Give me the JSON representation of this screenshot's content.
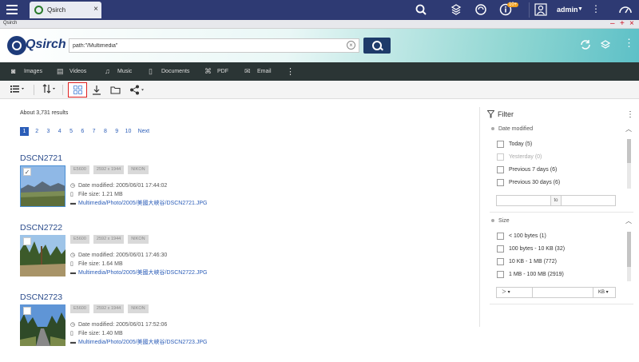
{
  "topbar": {
    "tab_label": "Qsirch",
    "tab_close": "×",
    "notification_badge": "10+",
    "user": "admin"
  },
  "window": {
    "title": "Qsirch"
  },
  "header": {
    "logo_text": "Qsirch",
    "search_value": "path:\"/Multimedia\""
  },
  "categories": [
    {
      "icon": "camera-icon",
      "label": "Images"
    },
    {
      "icon": "film-icon",
      "label": "Videos"
    },
    {
      "icon": "music-note-icon",
      "label": "Music"
    },
    {
      "icon": "document-icon",
      "label": "Documents"
    },
    {
      "icon": "pdf-icon",
      "label": "PDF"
    },
    {
      "icon": "email-icon",
      "label": "Email"
    }
  ],
  "results": {
    "count": "About 3,731 results",
    "pages": [
      "1",
      "2",
      "3",
      "4",
      "5",
      "6",
      "7",
      "8",
      "9",
      "10"
    ],
    "next": "Next",
    "active_page": "1",
    "items": [
      {
        "title": "DSCN2721",
        "tags": [
          "E5600",
          "2592 x 1944",
          "NIKON"
        ],
        "date": "Date modified: 2005/06/01 17:44:02",
        "size": "File size: 1.21 MB",
        "path": "Multimedia/Photo/2005/美國大峽谷/DSCN2721.JPG",
        "checked": true
      },
      {
        "title": "DSCN2722",
        "tags": [
          "E5600",
          "2592 x 1944",
          "NIKON"
        ],
        "date": "Date modified: 2005/06/01 17:46:30",
        "size": "File size: 1.64 MB",
        "path": "Multimedia/Photo/2005/美國大峽谷/DSCN2722.JPG",
        "checked": false
      },
      {
        "title": "DSCN2723",
        "tags": [
          "E5600",
          "2592 x 1944",
          "NIKON"
        ],
        "date": "Date modified: 2005/06/01 17:52:06",
        "size": "File size: 1.40 MB",
        "path": "Multimedia/Photo/2005/美國大峽谷/DSCN2723.JPG",
        "checked": false
      }
    ]
  },
  "filter": {
    "title": "Filter",
    "date_section": "Date modified",
    "date_options": [
      {
        "label": "Today (5)",
        "disabled": false
      },
      {
        "label": "Yesterday (0)",
        "disabled": true
      },
      {
        "label": "Previous 7 days (6)",
        "disabled": false
      },
      {
        "label": "Previous 30 days (6)",
        "disabled": false
      }
    ],
    "to_label": "to",
    "size_section": "Size",
    "size_options": [
      {
        "label": "< 100 bytes (1)"
      },
      {
        "label": "100 bytes - 10 KB (32)"
      },
      {
        "label": "10 KB - 1 MB (772)"
      },
      {
        "label": "1 MB - 100 MB (2919)"
      }
    ],
    "size_operator": "＞",
    "size_unit": "KB"
  }
}
